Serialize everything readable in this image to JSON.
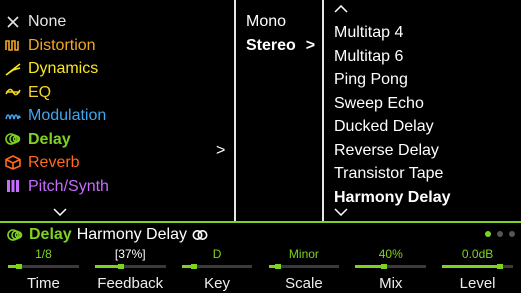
{
  "categories": {
    "items": [
      {
        "label": "None",
        "icon": "close-icon",
        "color": "#e6e6e6"
      },
      {
        "label": "Distortion",
        "icon": "distortion-icon",
        "color": "#f5a623"
      },
      {
        "label": "Dynamics",
        "icon": "dynamics-icon",
        "color": "#f8e71c"
      },
      {
        "label": "EQ",
        "icon": "eq-icon",
        "color": "#f5d523"
      },
      {
        "label": "Modulation",
        "icon": "modulation-icon",
        "color": "#3fa7f0"
      },
      {
        "label": "Delay",
        "icon": "delay-icon",
        "color": "#7ed321",
        "selected": true
      },
      {
        "label": "Reverb",
        "icon": "reverb-icon",
        "color": "#ff6a1e"
      },
      {
        "label": "Pitch/Synth",
        "icon": "pitch-synth-icon",
        "color": "#c86bff"
      }
    ],
    "arrow": ">"
  },
  "modes": {
    "items": [
      "Mono",
      "Stereo"
    ],
    "selected": "Stereo",
    "arrow": ">"
  },
  "models": {
    "items": [
      "Multitap 4",
      "Multitap 6",
      "Ping Pong",
      "Sweep Echo",
      "Ducked Delay",
      "Reverse Delay",
      "Transistor Tape",
      "Harmony Delay"
    ],
    "selected": "Harmony Delay"
  },
  "block": {
    "category": "Delay",
    "model": "Harmony Delay",
    "stereo_symbol": "ↀ",
    "color": "#7ed321",
    "page_dots": 3,
    "active_page": 1
  },
  "params": [
    {
      "name": "Time",
      "value": "1/8",
      "level": 0.16,
      "value_color": "#7ed321"
    },
    {
      "name": "Feedback",
      "value": "[37%]",
      "level": 0.37,
      "value_color": "#ffffff"
    },
    {
      "name": "Key",
      "value": "D",
      "level": 0.18,
      "value_color": "#7ed321"
    },
    {
      "name": "Scale",
      "value": "Minor",
      "level": 0.14,
      "value_color": "#7ed321"
    },
    {
      "name": "Mix",
      "value": "40%",
      "level": 0.4,
      "value_color": "#7ed321"
    },
    {
      "name": "Level",
      "value": "0.0dB",
      "level": 0.82,
      "value_color": "#7ed321"
    }
  ]
}
